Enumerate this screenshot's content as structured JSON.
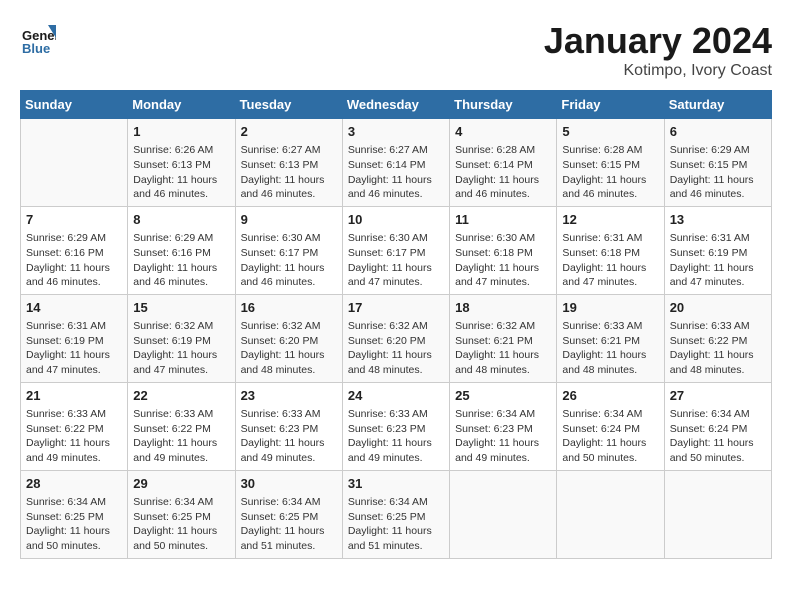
{
  "header": {
    "logo_line1": "General",
    "logo_line2": "Blue",
    "month_title": "January 2024",
    "location": "Kotimpo, Ivory Coast"
  },
  "days_of_week": [
    "Sunday",
    "Monday",
    "Tuesday",
    "Wednesday",
    "Thursday",
    "Friday",
    "Saturday"
  ],
  "weeks": [
    [
      {
        "day": "",
        "info": ""
      },
      {
        "day": "1",
        "info": "Sunrise: 6:26 AM\nSunset: 6:13 PM\nDaylight: 11 hours and 46 minutes."
      },
      {
        "day": "2",
        "info": "Sunrise: 6:27 AM\nSunset: 6:13 PM\nDaylight: 11 hours and 46 minutes."
      },
      {
        "day": "3",
        "info": "Sunrise: 6:27 AM\nSunset: 6:14 PM\nDaylight: 11 hours and 46 minutes."
      },
      {
        "day": "4",
        "info": "Sunrise: 6:28 AM\nSunset: 6:14 PM\nDaylight: 11 hours and 46 minutes."
      },
      {
        "day": "5",
        "info": "Sunrise: 6:28 AM\nSunset: 6:15 PM\nDaylight: 11 hours and 46 minutes."
      },
      {
        "day": "6",
        "info": "Sunrise: 6:29 AM\nSunset: 6:15 PM\nDaylight: 11 hours and 46 minutes."
      }
    ],
    [
      {
        "day": "7",
        "info": "Sunrise: 6:29 AM\nSunset: 6:16 PM\nDaylight: 11 hours and 46 minutes."
      },
      {
        "day": "8",
        "info": "Sunrise: 6:29 AM\nSunset: 6:16 PM\nDaylight: 11 hours and 46 minutes."
      },
      {
        "day": "9",
        "info": "Sunrise: 6:30 AM\nSunset: 6:17 PM\nDaylight: 11 hours and 46 minutes."
      },
      {
        "day": "10",
        "info": "Sunrise: 6:30 AM\nSunset: 6:17 PM\nDaylight: 11 hours and 47 minutes."
      },
      {
        "day": "11",
        "info": "Sunrise: 6:30 AM\nSunset: 6:18 PM\nDaylight: 11 hours and 47 minutes."
      },
      {
        "day": "12",
        "info": "Sunrise: 6:31 AM\nSunset: 6:18 PM\nDaylight: 11 hours and 47 minutes."
      },
      {
        "day": "13",
        "info": "Sunrise: 6:31 AM\nSunset: 6:19 PM\nDaylight: 11 hours and 47 minutes."
      }
    ],
    [
      {
        "day": "14",
        "info": "Sunrise: 6:31 AM\nSunset: 6:19 PM\nDaylight: 11 hours and 47 minutes."
      },
      {
        "day": "15",
        "info": "Sunrise: 6:32 AM\nSunset: 6:19 PM\nDaylight: 11 hours and 47 minutes."
      },
      {
        "day": "16",
        "info": "Sunrise: 6:32 AM\nSunset: 6:20 PM\nDaylight: 11 hours and 48 minutes."
      },
      {
        "day": "17",
        "info": "Sunrise: 6:32 AM\nSunset: 6:20 PM\nDaylight: 11 hours and 48 minutes."
      },
      {
        "day": "18",
        "info": "Sunrise: 6:32 AM\nSunset: 6:21 PM\nDaylight: 11 hours and 48 minutes."
      },
      {
        "day": "19",
        "info": "Sunrise: 6:33 AM\nSunset: 6:21 PM\nDaylight: 11 hours and 48 minutes."
      },
      {
        "day": "20",
        "info": "Sunrise: 6:33 AM\nSunset: 6:22 PM\nDaylight: 11 hours and 48 minutes."
      }
    ],
    [
      {
        "day": "21",
        "info": "Sunrise: 6:33 AM\nSunset: 6:22 PM\nDaylight: 11 hours and 49 minutes."
      },
      {
        "day": "22",
        "info": "Sunrise: 6:33 AM\nSunset: 6:22 PM\nDaylight: 11 hours and 49 minutes."
      },
      {
        "day": "23",
        "info": "Sunrise: 6:33 AM\nSunset: 6:23 PM\nDaylight: 11 hours and 49 minutes."
      },
      {
        "day": "24",
        "info": "Sunrise: 6:33 AM\nSunset: 6:23 PM\nDaylight: 11 hours and 49 minutes."
      },
      {
        "day": "25",
        "info": "Sunrise: 6:34 AM\nSunset: 6:23 PM\nDaylight: 11 hours and 49 minutes."
      },
      {
        "day": "26",
        "info": "Sunrise: 6:34 AM\nSunset: 6:24 PM\nDaylight: 11 hours and 50 minutes."
      },
      {
        "day": "27",
        "info": "Sunrise: 6:34 AM\nSunset: 6:24 PM\nDaylight: 11 hours and 50 minutes."
      }
    ],
    [
      {
        "day": "28",
        "info": "Sunrise: 6:34 AM\nSunset: 6:25 PM\nDaylight: 11 hours and 50 minutes."
      },
      {
        "day": "29",
        "info": "Sunrise: 6:34 AM\nSunset: 6:25 PM\nDaylight: 11 hours and 50 minutes."
      },
      {
        "day": "30",
        "info": "Sunrise: 6:34 AM\nSunset: 6:25 PM\nDaylight: 11 hours and 51 minutes."
      },
      {
        "day": "31",
        "info": "Sunrise: 6:34 AM\nSunset: 6:25 PM\nDaylight: 11 hours and 51 minutes."
      },
      {
        "day": "",
        "info": ""
      },
      {
        "day": "",
        "info": ""
      },
      {
        "day": "",
        "info": ""
      }
    ]
  ]
}
